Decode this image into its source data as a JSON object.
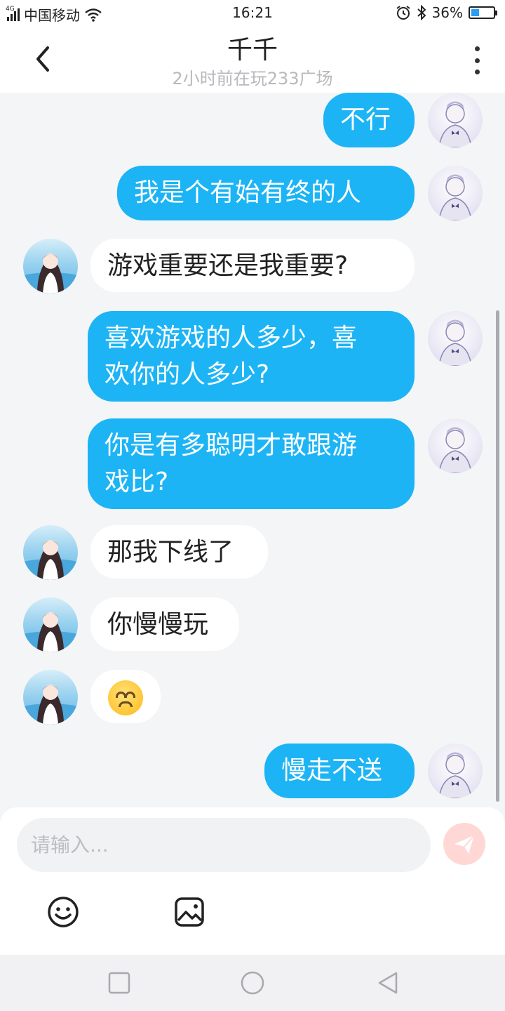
{
  "status_bar": {
    "network": "4G",
    "carrier": "中国移动",
    "time": "16:21",
    "battery_percent": "36%",
    "battery_level": 0.36
  },
  "header": {
    "title": "千千",
    "subtitle": "2小时前在玩233广场"
  },
  "messages": [
    {
      "sender": "me",
      "text": "不行"
    },
    {
      "sender": "me",
      "text": "我是个有始有终的人"
    },
    {
      "sender": "other",
      "text": "游戏重要还是我重要?"
    },
    {
      "sender": "me",
      "line1": "喜欢游戏的人多少，喜",
      "line2": "欢你的人多少?"
    },
    {
      "sender": "me",
      "line1": "你是有多聪明才敢跟游",
      "line2": "戏比?"
    },
    {
      "sender": "other",
      "text": "那我下线了"
    },
    {
      "sender": "other",
      "text": "你慢慢玩"
    },
    {
      "sender": "other",
      "emoji": "upside-down-face"
    },
    {
      "sender": "me",
      "text": "慢走不送"
    }
  ],
  "input": {
    "placeholder": "请输入..."
  },
  "colors": {
    "my_bubble": "#1cb4f5",
    "other_bubble": "#ffffff",
    "send_button": "#ffd8d6"
  },
  "icons": {
    "back": "chevron-left-icon",
    "more": "more-vertical-icon",
    "send": "paper-plane-icon",
    "emoji_tool": "smiley-icon",
    "image_tool": "image-icon",
    "nav": [
      "square-icon",
      "circle-icon",
      "triangle-back-icon"
    ]
  }
}
